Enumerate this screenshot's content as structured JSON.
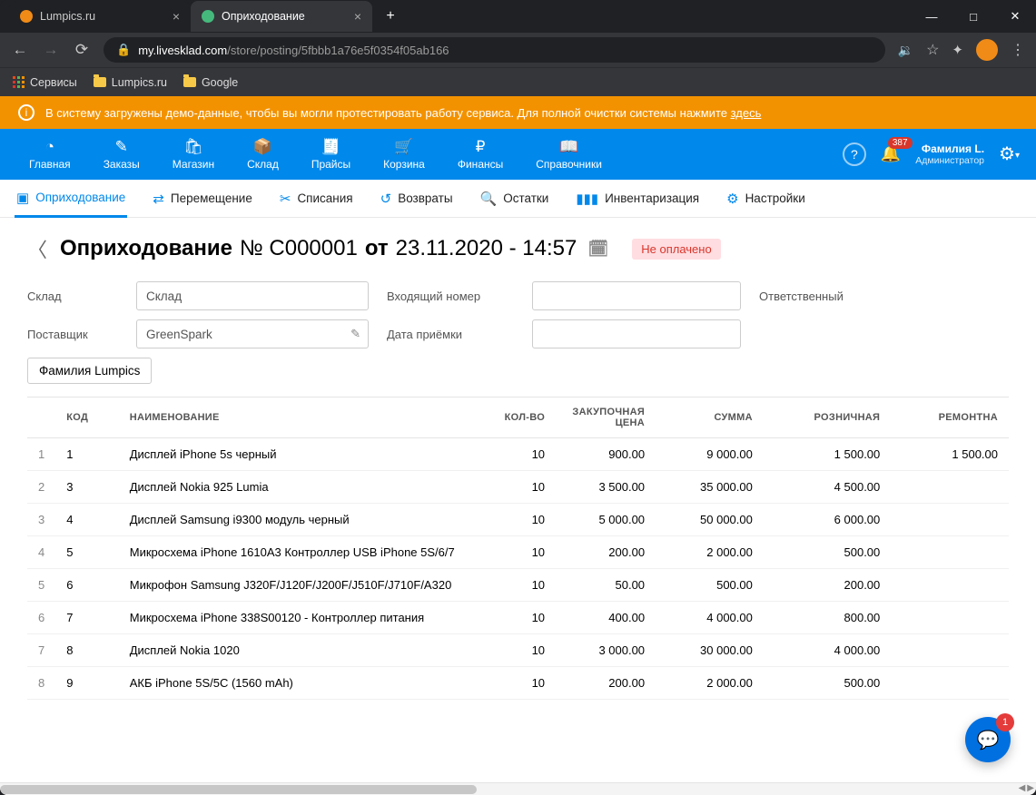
{
  "browser": {
    "tabs": [
      {
        "title": "Lumpics.ru",
        "active": false
      },
      {
        "title": "Оприходование",
        "active": true
      }
    ],
    "url_host": "my.livesklad.com",
    "url_path": "/store/posting/5fbbb1a76e5f0354f05ab166",
    "bookmarks": {
      "services": "Сервисы",
      "lumpics": "Lumpics.ru",
      "google": "Google"
    }
  },
  "banner": {
    "text": "В систему загружены демо-данные, чтобы вы могли протестировать работу сервиса. Для полной очистки системы нажмите ",
    "link": "здесь"
  },
  "topnav": {
    "items": [
      "Главная",
      "Заказы",
      "Магазин",
      "Склад",
      "Прайсы",
      "Корзина",
      "Финансы",
      "Справочники"
    ],
    "activeIndex": 3,
    "notifications": "387",
    "user_name": "Фамилия L.",
    "user_role": "Администратор"
  },
  "subnav": {
    "items": [
      "Оприходование",
      "Перемещение",
      "Списания",
      "Возвраты",
      "Остатки",
      "Инвентаризация",
      "Настройки"
    ],
    "activeIndex": 0
  },
  "doc": {
    "title_main": "Оприходование",
    "title_no": "№ С000001",
    "title_from": "от",
    "title_dt": "23.11.2020 - 14:57",
    "status": "Не оплачено",
    "labels": {
      "warehouse": "Склад",
      "supplier": "Поставщик",
      "incoming_no": "Входящий номер",
      "receipt_date": "Дата приёмки",
      "responsible": "Ответственный"
    },
    "values": {
      "warehouse": "Склад",
      "supplier": "GreenSpark",
      "responsible": "Фамилия Lumpics"
    }
  },
  "table": {
    "headers": {
      "code": "КОД",
      "name": "НАИМЕНОВАНИЕ",
      "qty": "КОЛ-ВО",
      "purchase": "ЗАКУПОЧНАЯ ЦЕНА",
      "sum": "СУММА",
      "retail": "РОЗНИЧНАЯ",
      "repair": "РЕМОНТНА"
    },
    "rows": [
      {
        "n": "1",
        "code": "1",
        "name": "Дисплей iPhone 5s черный",
        "qty": "10",
        "purchase": "900.00",
        "sum": "9 000.00",
        "retail": "1 500.00",
        "repair": "1 500.00"
      },
      {
        "n": "2",
        "code": "3",
        "name": "Дисплей Nokia 925 Lumia",
        "qty": "10",
        "purchase": "3 500.00",
        "sum": "35 000.00",
        "retail": "4 500.00",
        "repair": ""
      },
      {
        "n": "3",
        "code": "4",
        "name": "Дисплей Samsung i9300 модуль черный",
        "qty": "10",
        "purchase": "5 000.00",
        "sum": "50 000.00",
        "retail": "6 000.00",
        "repair": ""
      },
      {
        "n": "4",
        "code": "5",
        "name": "Микросхема iPhone 1610A3 Контроллер USB iPhone 5S/6/7",
        "qty": "10",
        "purchase": "200.00",
        "sum": "2 000.00",
        "retail": "500.00",
        "repair": ""
      },
      {
        "n": "5",
        "code": "6",
        "name": "Микрофон Samsung J320F/J120F/J200F/J510F/J710F/A320",
        "qty": "10",
        "purchase": "50.00",
        "sum": "500.00",
        "retail": "200.00",
        "repair": ""
      },
      {
        "n": "6",
        "code": "7",
        "name": "Микросхема iPhone 338S00120 - Контроллер питания",
        "qty": "10",
        "purchase": "400.00",
        "sum": "4 000.00",
        "retail": "800.00",
        "repair": ""
      },
      {
        "n": "7",
        "code": "8",
        "name": "Дисплей Nokia 1020",
        "qty": "10",
        "purchase": "3 000.00",
        "sum": "30 000.00",
        "retail": "4 000.00",
        "repair": ""
      },
      {
        "n": "8",
        "code": "9",
        "name": "АКБ iPhone 5S/5C (1560 mAh)",
        "qty": "10",
        "purchase": "200.00",
        "sum": "2 000.00",
        "retail": "500.00",
        "repair": ""
      }
    ]
  },
  "chat": {
    "unread": "1"
  }
}
